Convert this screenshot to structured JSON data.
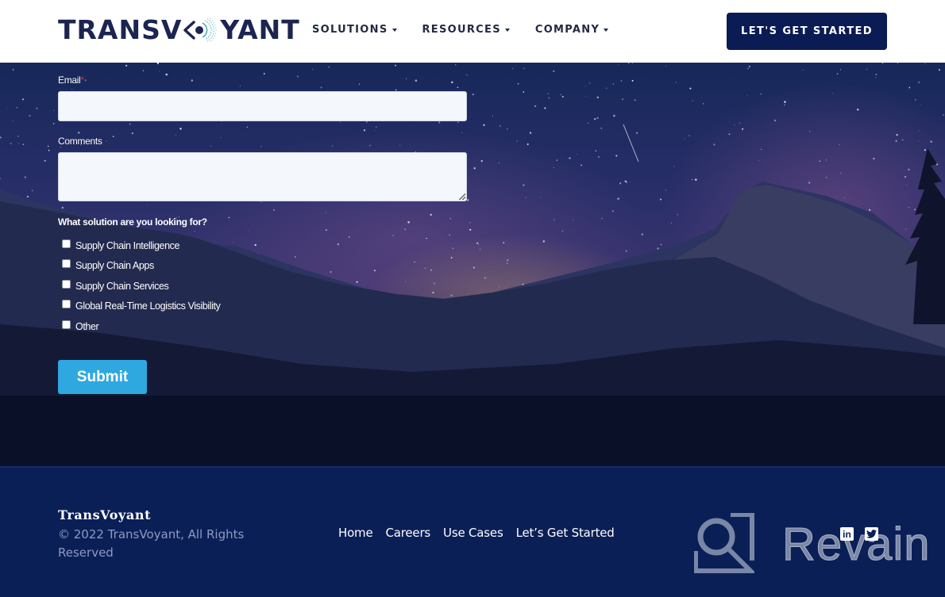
{
  "header": {
    "logo_left": "TRANSV",
    "logo_right": "YANT",
    "logo_icon": "eye-icon",
    "nav": [
      {
        "label": "SOLUTIONS",
        "icon": "caret-down-icon"
      },
      {
        "label": "RESOURCES",
        "icon": "caret-down-icon"
      },
      {
        "label": "COMPANY",
        "icon": "caret-down-icon"
      }
    ],
    "cta_label": "LET'S GET STARTED"
  },
  "form": {
    "email_label": "Email",
    "email_required_mark": "*",
    "email_value": "",
    "comments_label": "Comments",
    "comments_value": "",
    "question": "What solution are you looking for?",
    "options": [
      {
        "label": "Supply Chain Intelligence",
        "checked": false
      },
      {
        "label": "Supply Chain Apps",
        "checked": false
      },
      {
        "label": "Supply Chain Services",
        "checked": false
      },
      {
        "label": "Global Real-Time Logistics Visibility",
        "checked": false
      },
      {
        "label": "Other",
        "checked": false
      }
    ],
    "submit_label": "Submit"
  },
  "footer": {
    "brand": "TransVoyant",
    "copyright": "© 2022 TransVoyant, All Rights Reserved",
    "links": [
      {
        "label": "Home"
      },
      {
        "label": "Careers"
      },
      {
        "label": "Use Cases"
      },
      {
        "label": "Let’s Get Started"
      }
    ],
    "social": [
      {
        "name": "linkedin-icon",
        "glyph": "in"
      },
      {
        "name": "twitter-icon",
        "glyph": "🐦"
      }
    ],
    "watermark": "Revain"
  },
  "colors": {
    "brand_navy": "#0b1b53",
    "footer_bg": "#0b1f57",
    "submit_blue": "#2fa8e0",
    "logo_text": "#1b2550"
  }
}
